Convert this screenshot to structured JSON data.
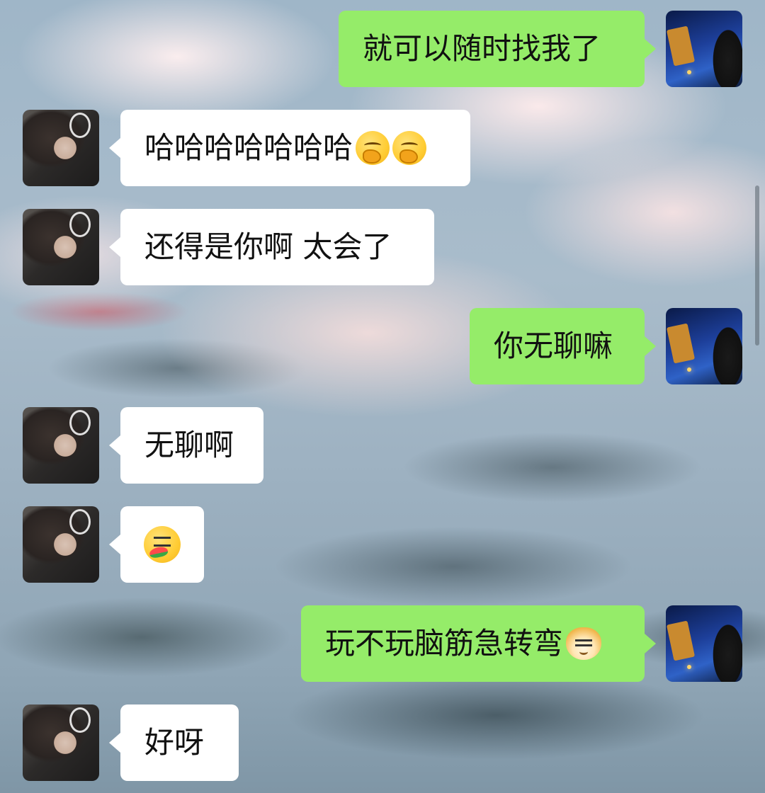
{
  "messages": [
    {
      "sender": "me",
      "text": "就可以随时找我了",
      "emoji": []
    },
    {
      "sender": "friend",
      "text": "哈哈哈哈哈哈哈",
      "emoji": [
        "face-with-hand-over-mouth",
        "face-with-hand-over-mouth"
      ]
    },
    {
      "sender": "friend",
      "text": "还得是你啊 太会了",
      "emoji": []
    },
    {
      "sender": "me",
      "text": "你无聊嘛",
      "emoji": []
    },
    {
      "sender": "friend",
      "text": "无聊啊",
      "emoji": []
    },
    {
      "sender": "friend",
      "text": "",
      "emoji": [
        "eating-watermelon-face"
      ]
    },
    {
      "sender": "me",
      "text": "玩不玩脑筋急转弯",
      "emoji": [
        "doge-face"
      ]
    },
    {
      "sender": "friend",
      "text": "好呀",
      "emoji": []
    }
  ],
  "colors": {
    "my_bubble": "#95ec69",
    "friend_bubble": "#ffffff",
    "text": "#111111"
  }
}
